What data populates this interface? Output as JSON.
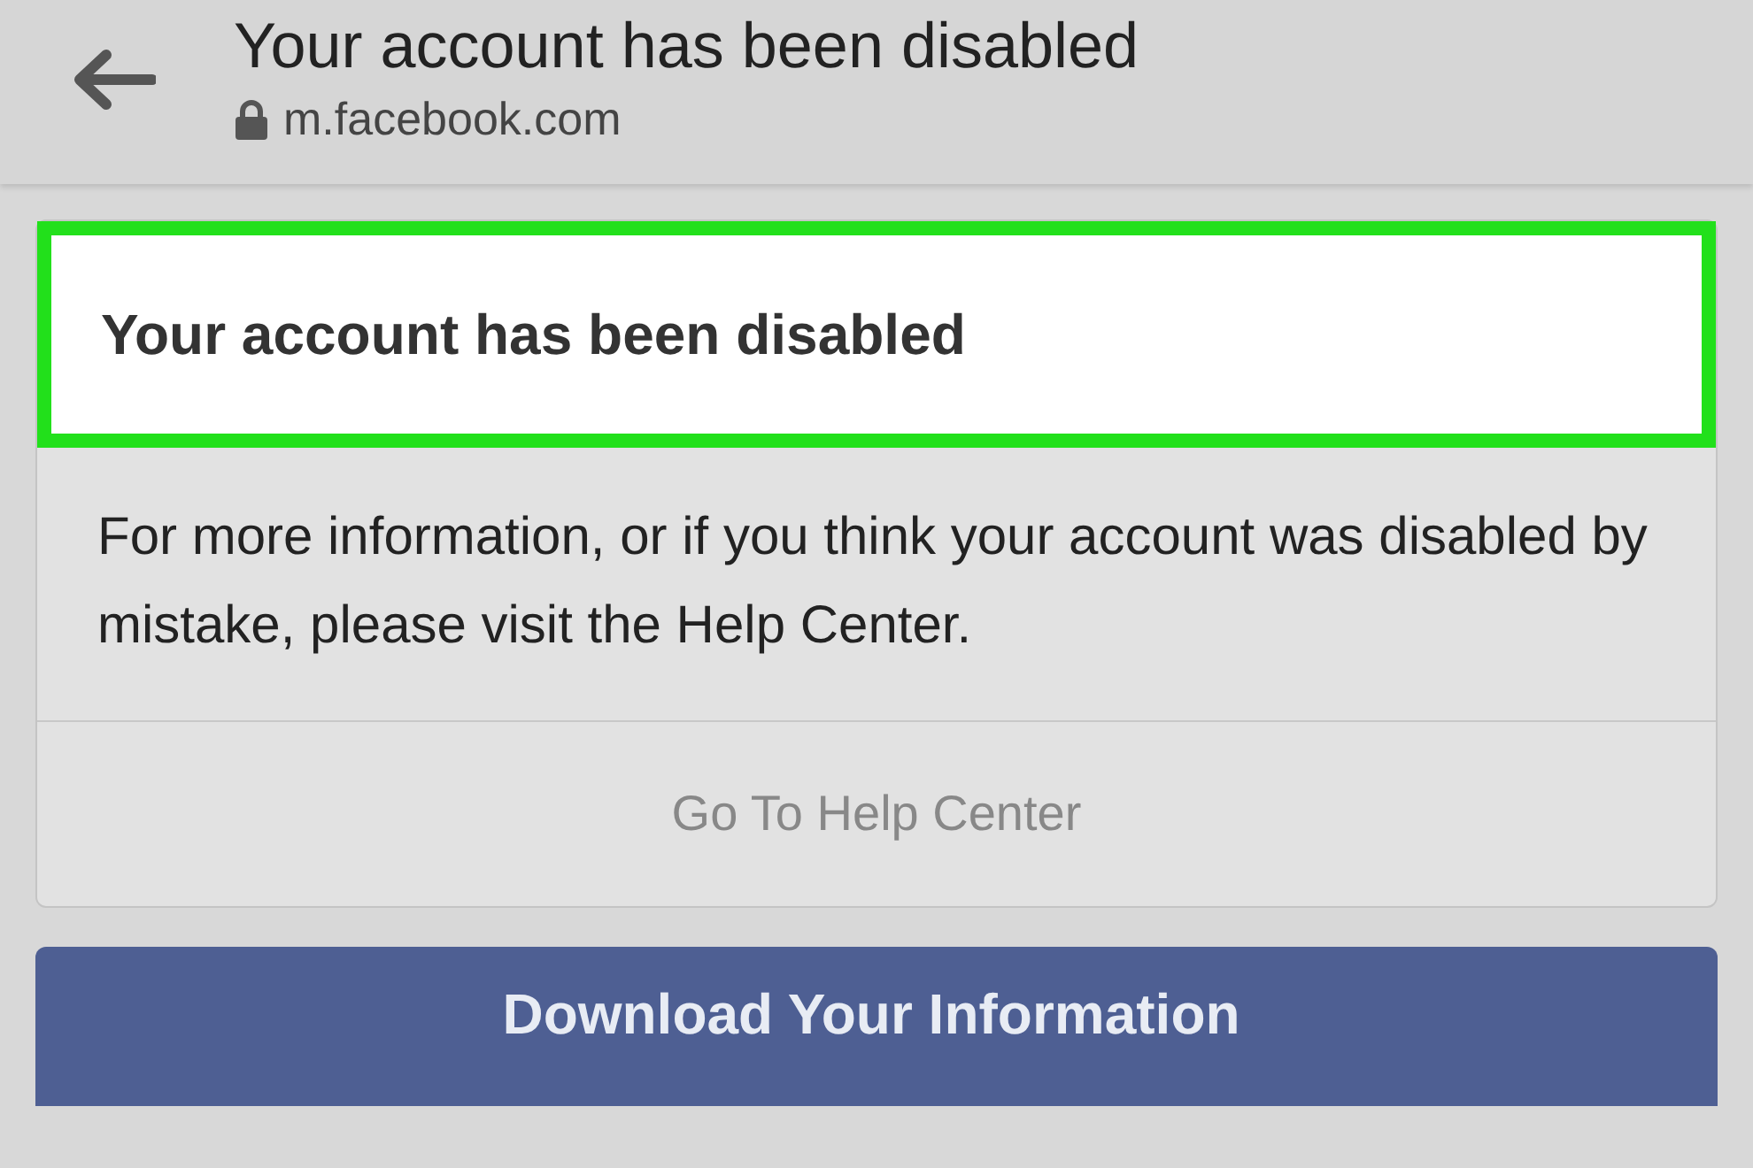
{
  "browser_bar": {
    "title": "Your account has been disabled",
    "url": "m.facebook.com"
  },
  "notice": {
    "heading": "Your account has been disabled",
    "highlighted": true,
    "message": "For more information, or if you think your account was disabled by mistake, please visit the Help Center.",
    "link": "Go To Help Center"
  },
  "primary_button": "Download Your Information"
}
